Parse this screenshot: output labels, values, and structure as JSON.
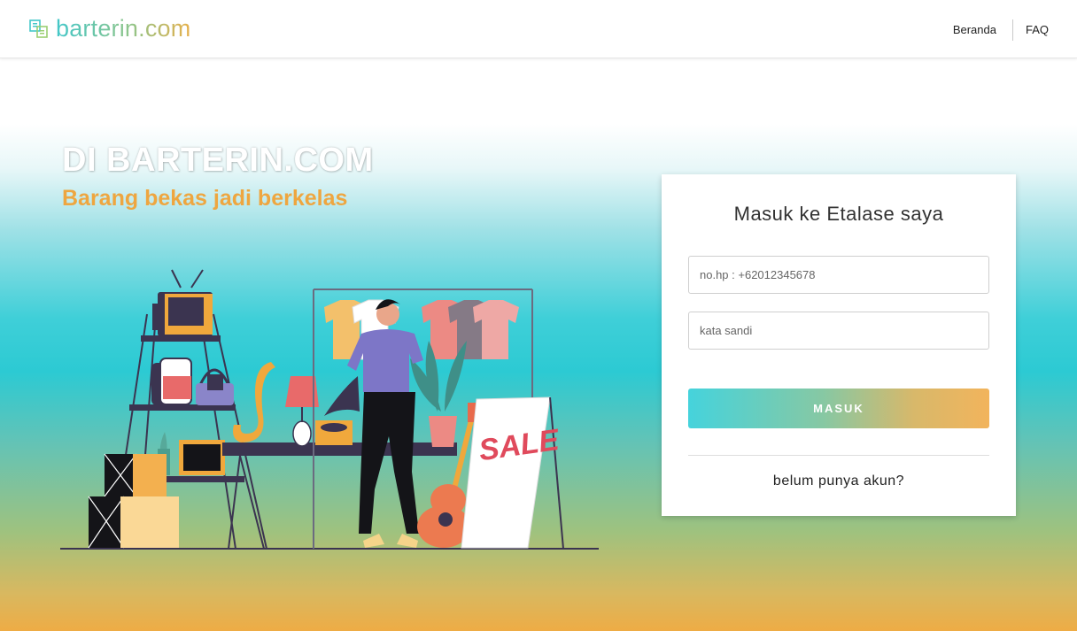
{
  "header": {
    "logo_text": "barterin.com",
    "logo_icon": "swap-icon",
    "nav": [
      {
        "label": "Beranda"
      },
      {
        "label": "FAQ"
      }
    ]
  },
  "hero": {
    "title": "DI BARTERIN.COM",
    "subtitle": "Barang bekas jadi berkelas",
    "illustration_sign": "SALE"
  },
  "login": {
    "title": "Masuk ke Etalase saya",
    "phone_placeholder": "no.hp : +62012345678",
    "password_placeholder": "kata sandi",
    "submit_label": "MASUK",
    "register_link": "belum punya akun?"
  },
  "colors": {
    "accent_teal": "#45d3dc",
    "accent_orange": "#eea640"
  }
}
